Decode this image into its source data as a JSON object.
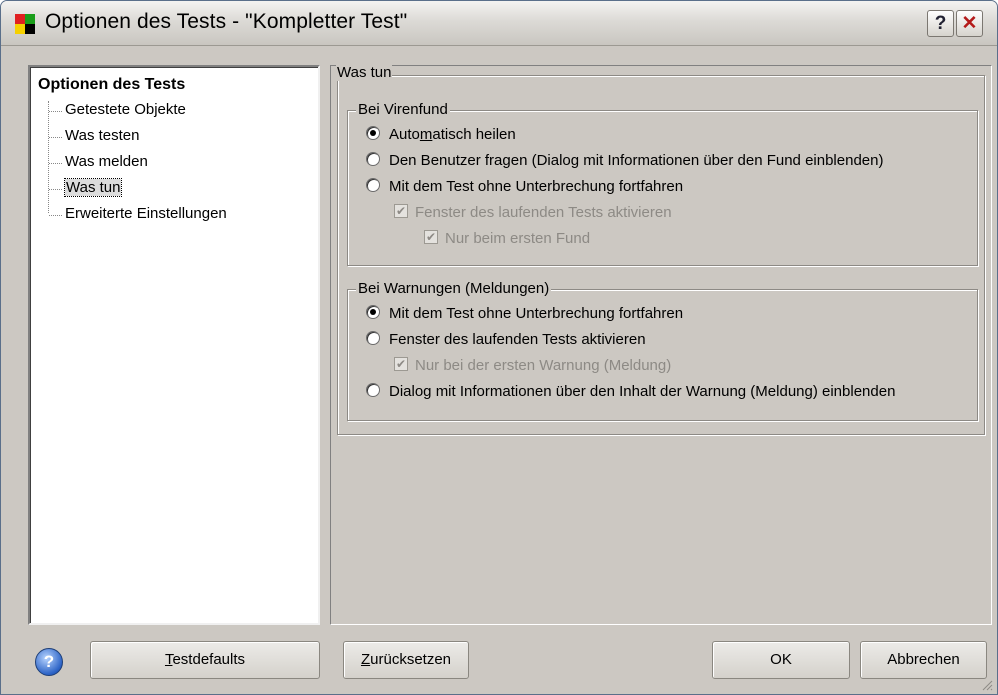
{
  "window": {
    "title": "Optionen des Tests - \"Kompletter Test\""
  },
  "titlebar_buttons": {
    "help": "?",
    "close": "✕"
  },
  "tree": {
    "root": "Optionen des Tests",
    "items": [
      {
        "label": "Getestete Objekte"
      },
      {
        "label": "Was testen"
      },
      {
        "label": "Was melden"
      },
      {
        "label": "Was tun",
        "selected": true
      },
      {
        "label": "Erweiterte Einstellungen"
      }
    ]
  },
  "main": {
    "group_title": "Was tun",
    "virus_group": {
      "title": "Bei Virenfund",
      "options": [
        {
          "label_pre": "Auto",
          "label_u": "m",
          "label_post": "atisch heilen",
          "selected": true
        },
        {
          "label": "Den Benutzer fragen (Dialog mit Informationen über den Fund einblenden)",
          "selected": false
        },
        {
          "label": "Mit dem Test ohne Unterbrechung fortfahren",
          "selected": false
        }
      ],
      "sub_checks": [
        {
          "label": "Fenster des laufenden Tests aktivieren",
          "checked": true,
          "enabled": false
        },
        {
          "label": "Nur beim ersten Fund",
          "checked": true,
          "enabled": false
        }
      ]
    },
    "warn_group": {
      "title": "Bei Warnungen (Meldungen)",
      "options": [
        {
          "label": "Mit dem Test ohne Unterbrechung fortfahren",
          "selected": true
        },
        {
          "label": "Fenster des laufenden Tests aktivieren",
          "selected": false
        },
        {
          "label": "Dialog mit Informationen über den Inhalt der Warnung (Meldung) einblenden",
          "selected": false
        }
      ],
      "sub_check": {
        "label": "Nur bei der ersten Warnung (Meldung)",
        "checked": true,
        "enabled": false
      }
    }
  },
  "footer": {
    "help_icon": "?",
    "testdefaults": {
      "u": "T",
      "rest": "estdefaults"
    },
    "reset": {
      "u": "Z",
      "rest": "urücksetzen"
    },
    "ok": "OK",
    "cancel": "Abbrechen"
  },
  "colors": {
    "icon_red": "#e02020",
    "icon_green": "#1a9e1a",
    "icon_yellow": "#f5d000",
    "icon_black": "#000000"
  }
}
